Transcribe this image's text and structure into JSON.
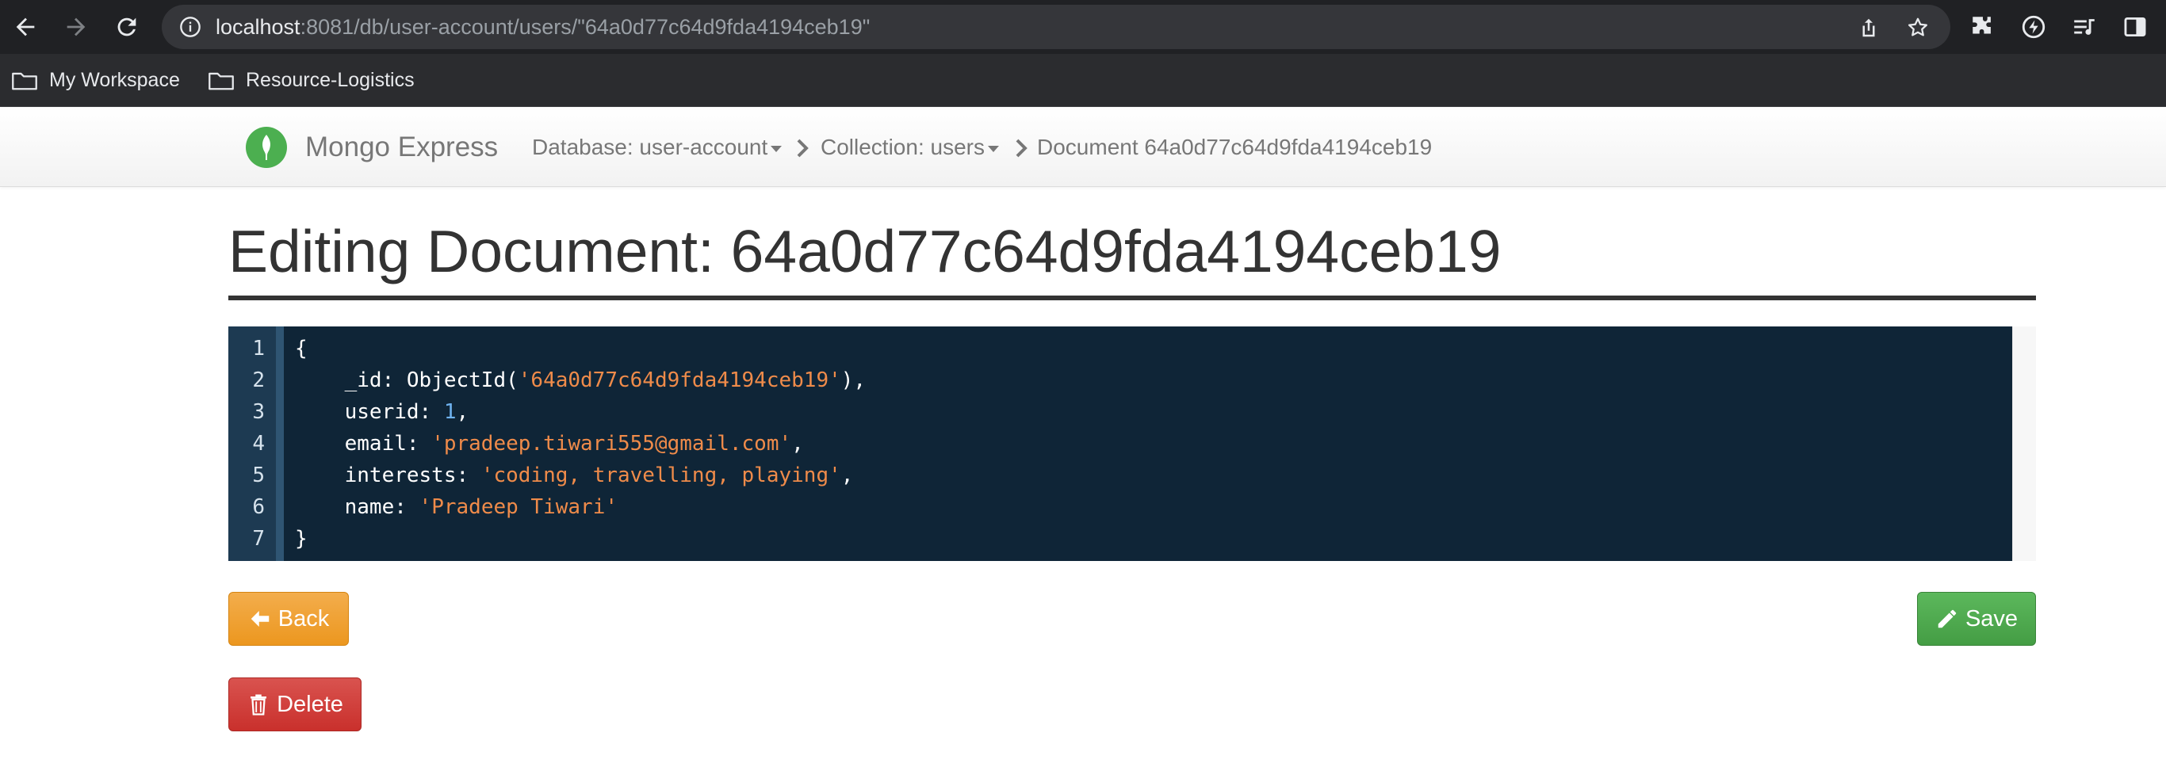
{
  "browser": {
    "url_host": "localhost",
    "url_rest": ":8081/db/user-account/users/\"64a0d77c64d9fda4194ceb19\"",
    "bookmarks": [
      {
        "label": "My Workspace",
        "icon": "folder-icon"
      },
      {
        "label": "Resource-Logistics",
        "icon": "folder-icon"
      }
    ]
  },
  "navbar": {
    "brand": "Mongo Express",
    "database_crumb": "Database: user-account",
    "collection_crumb": "Collection: users",
    "document_crumb": "Document 64a0d77c64d9fda4194ceb19"
  },
  "page": {
    "title": "Editing Document: 64a0d77c64d9fda4194ceb19"
  },
  "editor": {
    "line_numbers": [
      "1",
      "2",
      "3",
      "4",
      "5",
      "6",
      "7"
    ],
    "lines": [
      {
        "segments": [
          {
            "t": "{",
            "k": "plain"
          }
        ]
      },
      {
        "segments": [
          {
            "t": "    _id: ObjectId(",
            "k": "plain"
          },
          {
            "t": "'64a0d77c64d9fda4194ceb19'",
            "k": "str"
          },
          {
            "t": "),",
            "k": "plain"
          }
        ]
      },
      {
        "segments": [
          {
            "t": "    userid: ",
            "k": "plain"
          },
          {
            "t": "1",
            "k": "num"
          },
          {
            "t": ",",
            "k": "plain"
          }
        ]
      },
      {
        "segments": [
          {
            "t": "    email: ",
            "k": "plain"
          },
          {
            "t": "'pradeep.tiwari555@gmail.com'",
            "k": "str"
          },
          {
            "t": ",",
            "k": "plain"
          }
        ]
      },
      {
        "segments": [
          {
            "t": "    interests: ",
            "k": "plain"
          },
          {
            "t": "'coding, travelling, playing'",
            "k": "str"
          },
          {
            "t": ",",
            "k": "plain"
          }
        ]
      },
      {
        "segments": [
          {
            "t": "    name: ",
            "k": "plain"
          },
          {
            "t": "'Pradeep Tiwari'",
            "k": "str"
          }
        ]
      },
      {
        "segments": [
          {
            "t": "}",
            "k": "plain"
          }
        ]
      }
    ]
  },
  "buttons": {
    "back_label": "Back",
    "save_label": "Save",
    "delete_label": "Delete"
  },
  "colors": {
    "editor_bg": "#0f2537",
    "string": "#ef8b4a",
    "number": "#6fb3f0",
    "back": "#ec971f",
    "save": "#449d44",
    "delete": "#c9302c",
    "brand_logo": "#4caf50"
  }
}
